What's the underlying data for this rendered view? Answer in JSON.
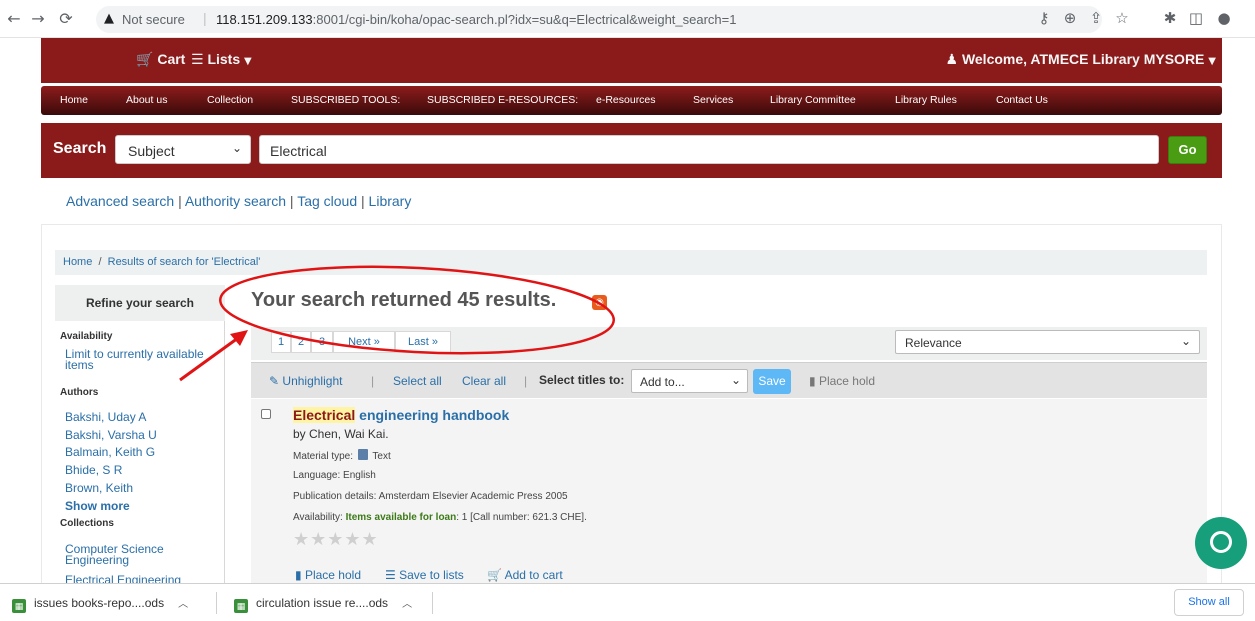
{
  "browser": {
    "not_secure": "Not secure",
    "url_host": "118.151.209.133",
    "url_rest": ":8001/cgi-bin/koha/opac-search.pl?idx=su&q=Electrical&weight_search=1"
  },
  "masthead": {
    "cart": "Cart",
    "lists": "Lists",
    "welcome": "Welcome, ATMECE Library MYSORE"
  },
  "menu": [
    "Home",
    "About us",
    "Collection",
    "SUBSCRIBED TOOLS:",
    "SUBSCRIBED E-RESOURCES:",
    "e-Resources",
    "Services",
    "Library Committee",
    "Library Rules",
    "Contact Us"
  ],
  "search": {
    "label": "Search",
    "index_value": "Subject",
    "query": "Electrical",
    "go": "Go"
  },
  "more_searches": [
    "Advanced search",
    "Authority search",
    "Tag cloud",
    "Library"
  ],
  "breadcrumb": {
    "home": "Home",
    "current": "Results of search for 'Electrical'"
  },
  "refine": {
    "heading": "Refine your search",
    "availability_label": "Availability",
    "availability_link": "Limit to currently available items",
    "authors_label": "Authors",
    "authors": [
      "Bakshi, Uday A",
      "Bakshi, Varsha U",
      "Balmain, Keith G",
      "Bhide, S R",
      "Brown, Keith"
    ],
    "show_more": "Show more",
    "collections_label": "Collections",
    "collections": [
      "Computer Science Engineering",
      "Electrical Engineering"
    ]
  },
  "results": {
    "heading": "Your search returned 45 results.",
    "pages": [
      "1",
      "2",
      "3",
      "Next »",
      "Last »"
    ],
    "sort": "Relevance"
  },
  "toolbar": {
    "unhighlight": "Unhighlight",
    "select_all": "Select all",
    "clear_all": "Clear all",
    "select_titles_label": "Select titles to:",
    "add_to": "Add to...",
    "save": "Save",
    "place_hold": "Place hold"
  },
  "result_item": {
    "title_highlight": "Electrical",
    "title_rest": " engineering handbook",
    "by": "by Chen, Wai Kai.",
    "material_label": "Material type:",
    "material_value": "Text",
    "language": "Language: English",
    "publication": "Publication details: Amsterdam Elsevier Academic Press 2005",
    "availability_label": "Availability:",
    "availability_value": "Items available for loan",
    "availability_rest": ": 1 [Call number: 621.3 CHE].",
    "actions": [
      "Place hold",
      "Save to lists",
      "Add to cart"
    ]
  },
  "downloads": {
    "items": [
      "issues books-repo....ods",
      "circulation issue re....ods"
    ],
    "show_all": "Show all"
  },
  "colors": {
    "brand": "#8b1a1a",
    "link": "#2a6fa8",
    "go_button": "#4a9c13",
    "annotation": "#e01414"
  }
}
